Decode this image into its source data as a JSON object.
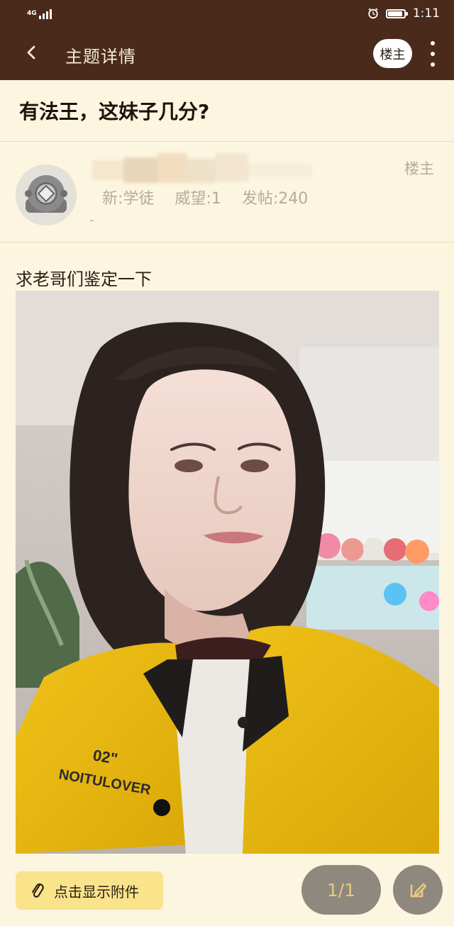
{
  "status_bar": {
    "network": "4G",
    "time": "1:11"
  },
  "app_bar": {
    "title": "主题详情",
    "author_button": "楼主",
    "icons": [
      "back-icon",
      "more-icon"
    ]
  },
  "thread": {
    "title": "有法王，这妹子几分?"
  },
  "poster": {
    "rank": "新:学徒",
    "prestige": "威望:1",
    "post_count": "发帖:240",
    "extra": "-",
    "floor_label": "楼主"
  },
  "post": {
    "text": "求老哥们鉴定一下"
  },
  "bottom_bar": {
    "attachment_button": "点击显示附件",
    "page_indicator": "1/1",
    "icons": [
      "paperclip-icon",
      "edit-icon"
    ]
  },
  "colors": {
    "header": "#4a2a1a",
    "background": "#fcf5e0",
    "attachment": "#f9e38b",
    "accent": "#e8c77f"
  }
}
